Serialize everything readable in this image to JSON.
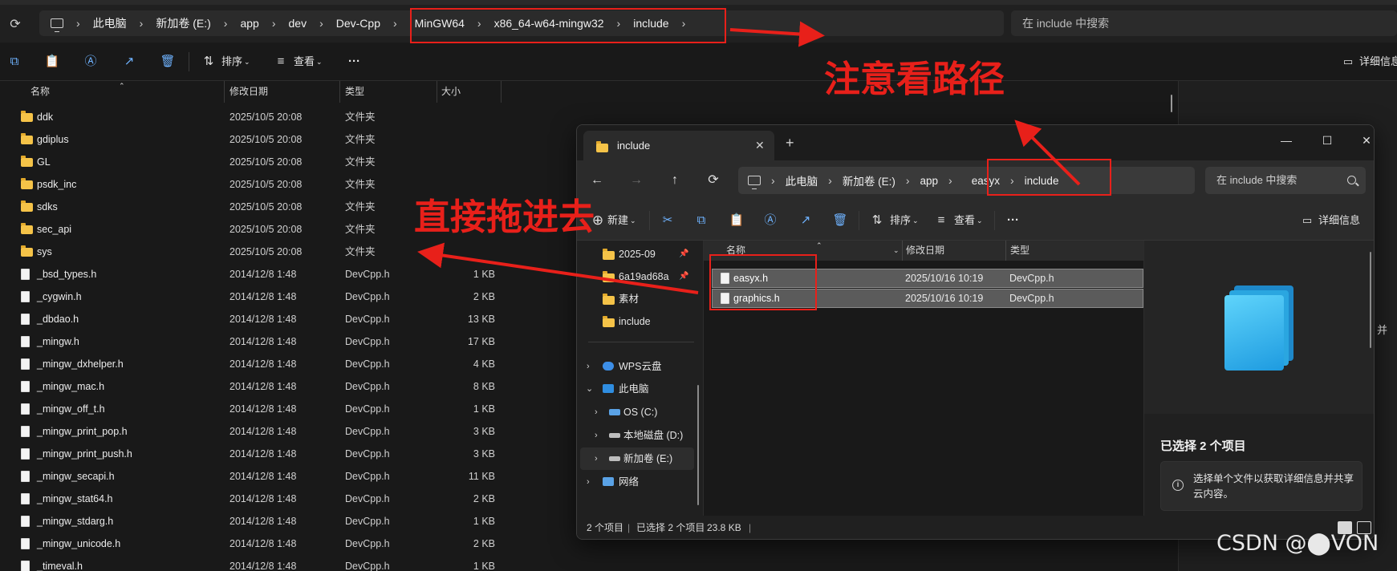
{
  "background_window": {
    "breadcrumb": [
      "此电脑",
      "新加卷 (E:)",
      "app",
      "dev",
      "Dev-Cpp",
      "MinGW64",
      "x86_64-w64-mingw32",
      "include"
    ],
    "search_placeholder": "在 include 中搜索",
    "toolbar": {
      "sort_label": "排序",
      "view_label": "查看",
      "more_label": "···",
      "details_label": "详细信息"
    },
    "columns": {
      "name": "名称",
      "date": "修改日期",
      "type": "类型",
      "size": "大小"
    },
    "files": [
      {
        "name": "ddk",
        "date": "2025/10/5 20:08",
        "type": "文件夹",
        "size": "",
        "kind": "folder"
      },
      {
        "name": "gdiplus",
        "date": "2025/10/5 20:08",
        "type": "文件夹",
        "size": "",
        "kind": "folder"
      },
      {
        "name": "GL",
        "date": "2025/10/5 20:08",
        "type": "文件夹",
        "size": "",
        "kind": "folder"
      },
      {
        "name": "psdk_inc",
        "date": "2025/10/5 20:08",
        "type": "文件夹",
        "size": "",
        "kind": "folder"
      },
      {
        "name": "sdks",
        "date": "2025/10/5 20:08",
        "type": "文件夹",
        "size": "",
        "kind": "folder"
      },
      {
        "name": "sec_api",
        "date": "2025/10/5 20:08",
        "type": "文件夹",
        "size": "",
        "kind": "folder"
      },
      {
        "name": "sys",
        "date": "2025/10/5 20:08",
        "type": "文件夹",
        "size": "",
        "kind": "folder"
      },
      {
        "name": "_bsd_types.h",
        "date": "2014/12/8 1:48",
        "type": "DevCpp.h",
        "size": "1 KB",
        "kind": "file"
      },
      {
        "name": "_cygwin.h",
        "date": "2014/12/8 1:48",
        "type": "DevCpp.h",
        "size": "2 KB",
        "kind": "file"
      },
      {
        "name": "_dbdao.h",
        "date": "2014/12/8 1:48",
        "type": "DevCpp.h",
        "size": "13 KB",
        "kind": "file"
      },
      {
        "name": "_mingw.h",
        "date": "2014/12/8 1:48",
        "type": "DevCpp.h",
        "size": "17 KB",
        "kind": "file"
      },
      {
        "name": "_mingw_dxhelper.h",
        "date": "2014/12/8 1:48",
        "type": "DevCpp.h",
        "size": "4 KB",
        "kind": "file"
      },
      {
        "name": "_mingw_mac.h",
        "date": "2014/12/8 1:48",
        "type": "DevCpp.h",
        "size": "8 KB",
        "kind": "file"
      },
      {
        "name": "_mingw_off_t.h",
        "date": "2014/12/8 1:48",
        "type": "DevCpp.h",
        "size": "1 KB",
        "kind": "file"
      },
      {
        "name": "_mingw_print_pop.h",
        "date": "2014/12/8 1:48",
        "type": "DevCpp.h",
        "size": "3 KB",
        "kind": "file"
      },
      {
        "name": "_mingw_print_push.h",
        "date": "2014/12/8 1:48",
        "type": "DevCpp.h",
        "size": "3 KB",
        "kind": "file"
      },
      {
        "name": "_mingw_secapi.h",
        "date": "2014/12/8 1:48",
        "type": "DevCpp.h",
        "size": "11 KB",
        "kind": "file"
      },
      {
        "name": "_mingw_stat64.h",
        "date": "2014/12/8 1:48",
        "type": "DevCpp.h",
        "size": "2 KB",
        "kind": "file"
      },
      {
        "name": "_mingw_stdarg.h",
        "date": "2014/12/8 1:48",
        "type": "DevCpp.h",
        "size": "1 KB",
        "kind": "file"
      },
      {
        "name": "_mingw_unicode.h",
        "date": "2014/12/8 1:48",
        "type": "DevCpp.h",
        "size": "2 KB",
        "kind": "file"
      },
      {
        "name": "_timeval.h",
        "date": "2014/12/8 1:48",
        "type": "DevCpp.h",
        "size": "1 KB",
        "kind": "file"
      }
    ],
    "right_panel_fragment": "并"
  },
  "foreground_window": {
    "tab_title": "include",
    "breadcrumb": [
      "此电脑",
      "新加卷 (E:)",
      "app",
      "easyx",
      "include"
    ],
    "search_placeholder": "在 include 中搜索",
    "toolbar": {
      "new_label": "新建",
      "sort_label": "排序",
      "view_label": "查看",
      "more_label": "···",
      "details_label": "详细信息"
    },
    "nav_items": [
      {
        "label": "2025-09",
        "pinned": true
      },
      {
        "label": "6a19ad68a",
        "pinned": true
      },
      {
        "label": "素材",
        "pinned": false
      },
      {
        "label": "include",
        "pinned": false
      }
    ],
    "nav_tree": [
      {
        "label": "WPS云盘",
        "expanded": false
      },
      {
        "label": "此电脑",
        "expanded": true
      },
      {
        "label": "OS (C:)",
        "expanded": false
      },
      {
        "label": "本地磁盘 (D:)",
        "expanded": false
      },
      {
        "label": "新加卷 (E:)",
        "expanded": false,
        "selected": true
      },
      {
        "label": "网络",
        "expanded": false
      }
    ],
    "columns": {
      "name": "名称",
      "date": "修改日期",
      "type": "类型"
    },
    "files": [
      {
        "name": "easyx.h",
        "date": "2025/10/16 10:19",
        "type": "DevCpp.h"
      },
      {
        "name": "graphics.h",
        "date": "2025/10/16 10:19",
        "type": "DevCpp.h"
      }
    ],
    "detail_title": "已选择 2 个项目",
    "detail_info": "选择单个文件以获取详细信息并共享云内容。",
    "status": {
      "count": "2 个项目",
      "selected": "已选择 2 个项目",
      "size": "23.8 KB"
    }
  },
  "annotations": {
    "path_note": "注意看路径",
    "drag_note": "直接拖进去",
    "color": "#e8201a"
  },
  "watermark": "CSDN @⬤VON",
  "colors": {
    "bg": "#191919",
    "accent": "#6fb3ff",
    "folder": "#f5c348",
    "annotation": "#e8201a"
  }
}
